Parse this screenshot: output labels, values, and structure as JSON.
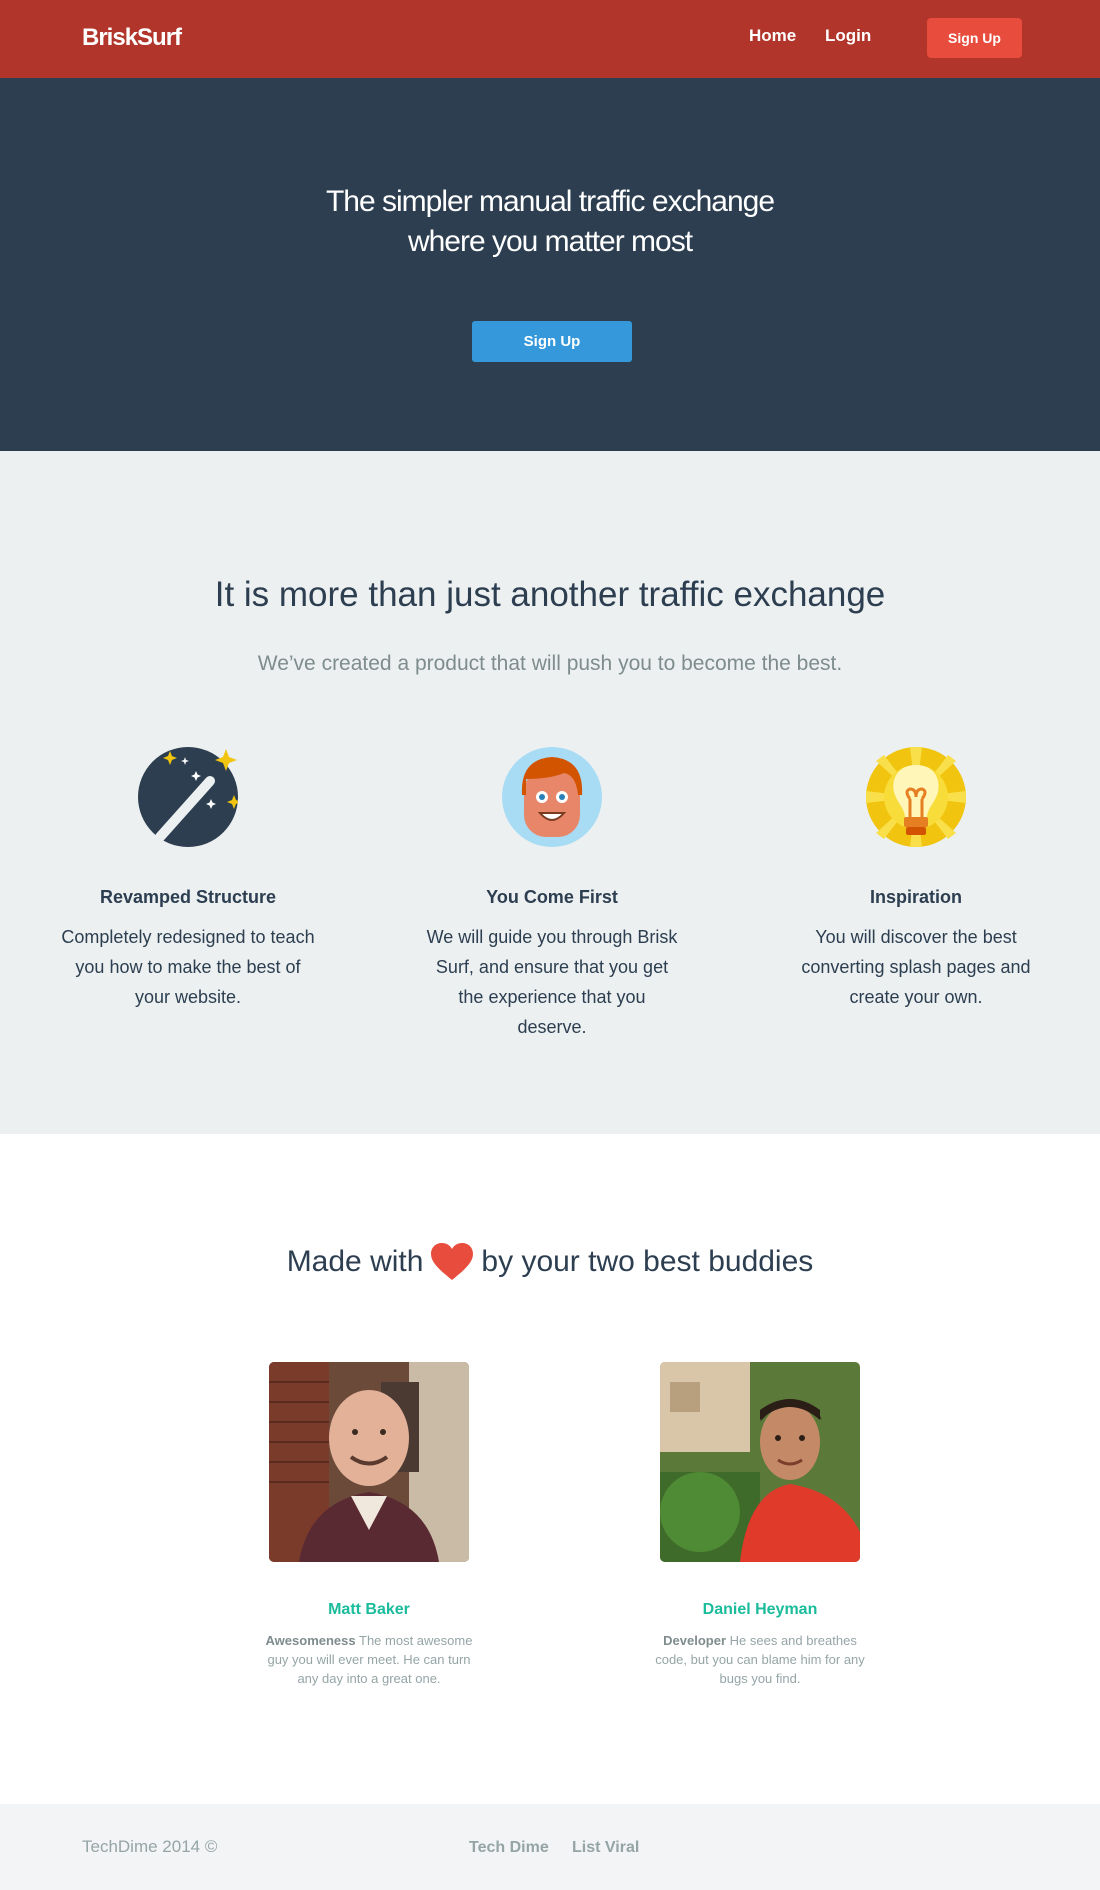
{
  "nav": {
    "logo": "BriskSurf",
    "home": "Home",
    "login": "Login",
    "signup": "Sign Up",
    "bg_color": "#b1352a",
    "signup_color": "#e74c3c"
  },
  "hero": {
    "title_line1": "The simpler manual traffic exchange",
    "title_line2": "where you matter most",
    "button": "Sign Up",
    "bg_color": "#2c3e50",
    "button_color": "#3498db"
  },
  "features": {
    "heading": "It is more than just another traffic exchange",
    "subheading": "We’ve created a product that will push you to become the best.",
    "items": [
      {
        "icon": "magic-wand-icon",
        "title": "Revamped Structure",
        "desc": "Completely redesigned to teach you how to make the best of your website."
      },
      {
        "icon": "smiling-face-icon",
        "title": "You Come First",
        "desc": "We will guide you through Brisk Surf, and ensure that you get the experience that you deserve."
      },
      {
        "icon": "lightbulb-icon",
        "title": "Inspiration",
        "desc": "You will discover the best converting splash pages and create your own."
      }
    ]
  },
  "team": {
    "heading_before": "Made with",
    "heading_after": "by your two best buddies",
    "heart_icon": "heart-icon",
    "members": [
      {
        "name": "Matt Baker",
        "role": "Awesomeness",
        "bio": "The most awesome guy you will ever meet. He can turn any day into a great one."
      },
      {
        "name": "Daniel Heyman",
        "role": "Developer",
        "bio": "He sees and breathes code, but you can blame him for any bugs you find."
      }
    ],
    "name_color": "#1abc9c"
  },
  "footer": {
    "copyright": "TechDime 2014 ©",
    "links": [
      "Tech Dime",
      "List Viral"
    ]
  }
}
